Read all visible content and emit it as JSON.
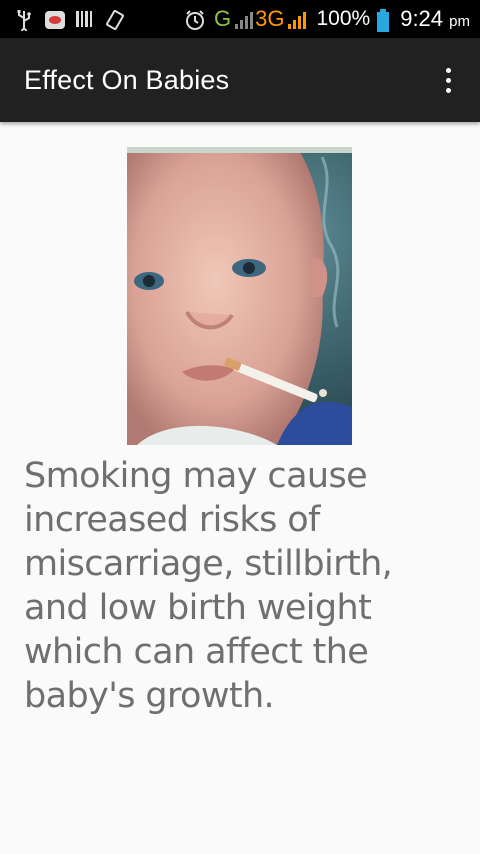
{
  "status_bar": {
    "network_label": "G",
    "network_3g_label": "3G",
    "battery": "100%",
    "time": "9:24",
    "am_pm": "pm",
    "icons": [
      "usb-icon",
      "notification-icon",
      "barcode-icon",
      "vibrate-icon",
      "alarm-icon",
      "signal-icon",
      "signal-icon",
      "battery-icon"
    ]
  },
  "app_bar": {
    "title": "Effect On Babies",
    "menu_icon": "more-vert-icon"
  },
  "content": {
    "image_alt": "Baby with cigarette photo",
    "text": "Smoking may cause increased risks of miscarriage, stillbirth, and low birth weight which can affect the baby's growth."
  },
  "colors": {
    "status_bar": "#000000",
    "app_bar": "#212121",
    "background": "#fafafa",
    "text": "#6f6f6f",
    "accent_green": "#8bc34a",
    "accent_orange": "#ff9800",
    "battery_blue": "#29a8e0"
  }
}
